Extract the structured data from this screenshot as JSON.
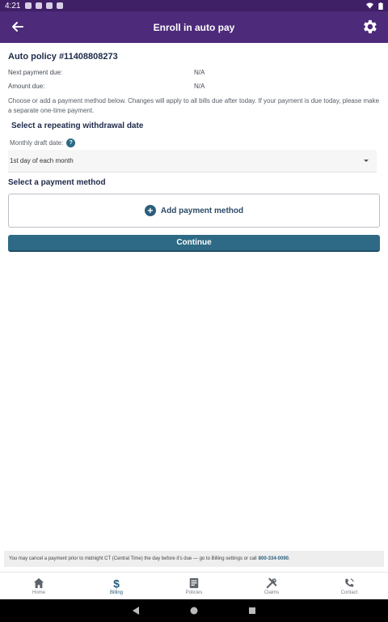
{
  "status_bar": {
    "time": "4:21"
  },
  "app_bar": {
    "title": "Enroll in auto pay"
  },
  "policy": {
    "title": "Auto policy #11408808273",
    "next_payment_label": "Next payment due:",
    "next_payment_value": "N/A",
    "amount_label": "Amount due:",
    "amount_value": "N/A"
  },
  "description": "Choose or add a payment method below. Changes will apply to all bills due after today. If your payment is due today, please make a separate one-time payment.",
  "withdrawal": {
    "heading": "Select a repeating withdrawal date",
    "label": "Monthly draft date:",
    "help": "?",
    "selected": "1st day of each month"
  },
  "payment_method": {
    "heading": "Select a payment method",
    "add_label": "Add payment method",
    "add_symbol": "+"
  },
  "continue_label": "Continue",
  "notice": {
    "text": "You may cancel a payment prior to midnight CT (Central Time) the day before it's due — go to Billing settings or call",
    "phone": "800-334-0090",
    "end": "."
  },
  "bottom_nav": [
    {
      "label": "Home",
      "icon": "home-icon"
    },
    {
      "label": "Billing",
      "icon": "dollar-icon",
      "active": true
    },
    {
      "label": "Policies",
      "icon": "document-icon"
    },
    {
      "label": "Claims",
      "icon": "tools-icon"
    },
    {
      "label": "Contact",
      "icon": "phone-icon"
    }
  ],
  "colors": {
    "app_bar": "#4d2a7a",
    "status_bar": "#3f1f66",
    "primary_button": "#2e6a86",
    "accent": "#2b5e7c"
  }
}
